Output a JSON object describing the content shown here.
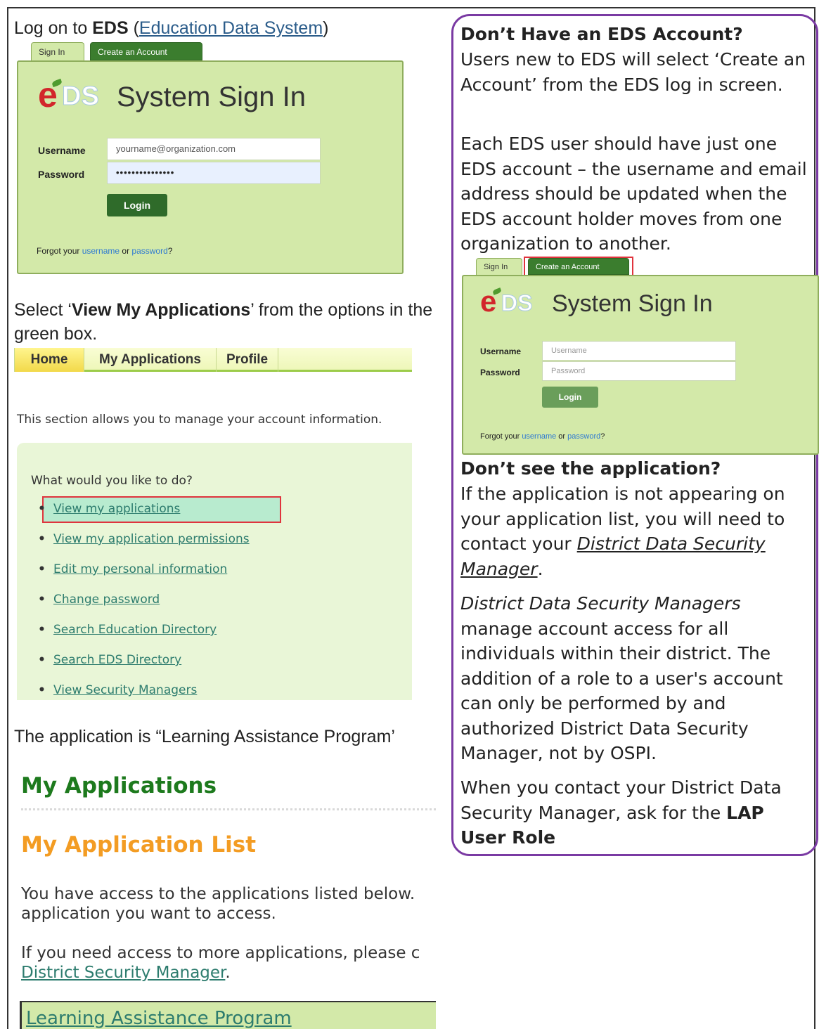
{
  "left": {
    "intro": {
      "prefix": "Log on to ",
      "bold": "EDS",
      "link": "Education Data System",
      "paren_open": " (",
      "paren_close": ")"
    },
    "signin1": {
      "tab_signin": "Sign In",
      "tab_create": "Create an Account",
      "logo_e": "e",
      "logo_ds": "DS",
      "title": "System Sign In",
      "username_label": "Username",
      "password_label": "Password",
      "username_value": "yourname@organization.com",
      "password_value": "•••••••••••••••",
      "login": "Login",
      "forgot_prefix": "Forgot your ",
      "forgot_username": "username",
      "forgot_or": " or ",
      "forgot_password": "password",
      "forgot_suffix": "?"
    },
    "select": {
      "prefix": "Select ‘",
      "bold": "View My Applications",
      "suffix": "’ from the options in the green box."
    },
    "menu": [
      "Home",
      "My Applications",
      "Profile"
    ],
    "section_text": "This section allows you to manage your account information.",
    "options_question": "What would you like to do?",
    "options": [
      "View my applications",
      "View my application permissions",
      "Edit my personal information",
      "Change password",
      "Search Education Directory",
      "Search EDS Directory",
      "View Security Managers"
    ],
    "application_line": "The application is “Learning Assistance Program’",
    "my_applications": "My Applications",
    "my_application_list": "My Application List",
    "access_line1": "You have access to the applications listed below.",
    "access_line2": "application you want to access.",
    "more_line1": "If you need access to more applications, please c",
    "more_link": "District Security Manager",
    "more_period": ".",
    "lap_link": "Learning Assistance Program"
  },
  "right": {
    "heading1": "Don’t Have an EDS Account?",
    "para1": "Users new to EDS will select ‘Create an Account’ from the EDS log in screen.",
    "para2": "Each EDS user should have just one EDS account – the username and email address should be updated when the EDS account holder moves from one organization to another.",
    "signin2": {
      "tab_signin": "Sign In",
      "tab_create": "Create an Account",
      "logo_e": "e",
      "logo_ds": "DS",
      "title": "System Sign In",
      "username_label": "Username",
      "password_label": "Password",
      "username_placeholder": "Username",
      "password_placeholder": "Password",
      "login": "Login",
      "forgot_prefix": "Forgot your ",
      "forgot_username": "username",
      "forgot_or": " or ",
      "forgot_password": "password",
      "forgot_suffix": "?"
    },
    "heading2": "Don’t see the application?",
    "para3_prefix": "If the application is not appearing on your application list, you will need to contact your ",
    "para3_link": "District Data Security Manager",
    "para3_suffix": ".",
    "para4_italic": "District Data Security Managers",
    "para4_rest": " manage account access for all individuals within their district. The addition of a role to a user's account can only be performed by and authorized District Data Security Manager, not by OSPI.",
    "para5_prefix": "When you contact your District Data Security Manager, ask for the ",
    "para5_bold": "LAP User Role"
  },
  "colors": {
    "green_box": "#d3e9a9",
    "dark_green": "#2f6b2a",
    "purple_border": "#7a3aa3",
    "highlight_red": "#e0343d",
    "orange_heading": "#f39c23",
    "green_heading": "#1d7a1d"
  }
}
